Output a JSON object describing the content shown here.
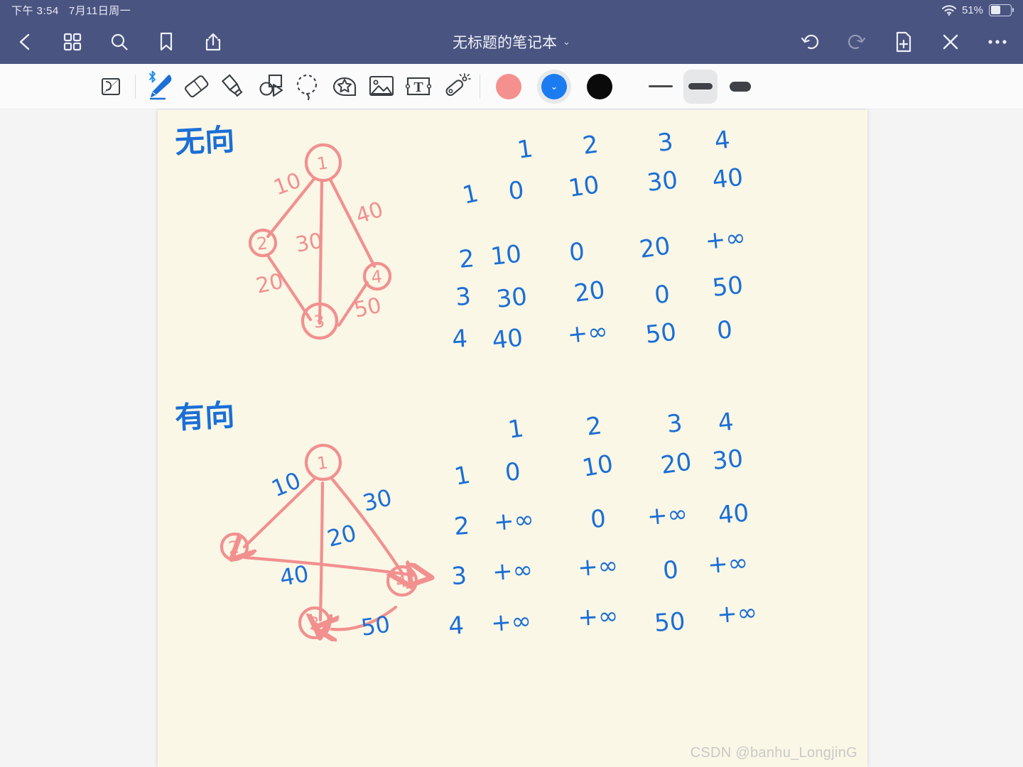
{
  "statusbar": {
    "time": "下午 3:54",
    "date": "7月11日周一",
    "battery_percent": "51%",
    "wifi_icon": "wifi-icon",
    "battery_icon": "battery-icon"
  },
  "navbar": {
    "title": "无标题的笔记本",
    "title_chevron": "⌄",
    "left_items": [
      {
        "name": "back-button",
        "icon": "chevron-left-icon"
      },
      {
        "name": "grid-view-button",
        "icon": "grid-icon"
      },
      {
        "name": "search-button",
        "icon": "search-icon"
      },
      {
        "name": "bookmark-button",
        "icon": "bookmark-icon"
      },
      {
        "name": "share-button",
        "icon": "share-icon"
      }
    ],
    "right_items": [
      {
        "name": "undo-button",
        "icon": "undo-icon"
      },
      {
        "name": "redo-button",
        "icon": "redo-icon"
      },
      {
        "name": "add-page-button",
        "icon": "document-plus-icon"
      },
      {
        "name": "close-button",
        "icon": "close-x-icon"
      },
      {
        "name": "more-button",
        "icon": "more-dots-icon"
      }
    ]
  },
  "toolbar": {
    "tools": [
      {
        "name": "page-flip-tool",
        "icon": "page-corner-icon",
        "active": false
      },
      {
        "name": "pen-tool",
        "icon": "pen-icon",
        "active": true,
        "badge": "bluetooth-icon"
      },
      {
        "name": "eraser-tool",
        "icon": "eraser-icon",
        "active": false
      },
      {
        "name": "highlighter-tool",
        "icon": "highlighter-icon",
        "active": false
      },
      {
        "name": "shapes-tool",
        "icon": "shapes-icon",
        "active": false
      },
      {
        "name": "lasso-tool",
        "icon": "lasso-dashed-circle-icon",
        "active": false
      },
      {
        "name": "sticker-tool",
        "icon": "star-sticker-icon",
        "active": false
      },
      {
        "name": "image-tool",
        "icon": "image-icon",
        "active": false
      },
      {
        "name": "text-tool",
        "icon": "text-box-icon",
        "active": false
      },
      {
        "name": "magic-tool",
        "icon": "magic-wand-icon",
        "active": false
      }
    ],
    "colors": [
      {
        "name": "color-swatch-salmon",
        "hex": "#f4918e",
        "selected": false
      },
      {
        "name": "color-swatch-blue",
        "hex": "#1a7cf0",
        "selected": true
      },
      {
        "name": "color-swatch-black",
        "hex": "#0a0a0a",
        "selected": false
      }
    ],
    "strokes": [
      {
        "name": "stroke-width-thin",
        "selected": false
      },
      {
        "name": "stroke-width-medium",
        "selected": true
      },
      {
        "name": "stroke-width-thick",
        "selected": false
      }
    ]
  },
  "canvas": {
    "watermark": "CSDN @banhu_LongjinG",
    "ink_colors": {
      "pink": "#f2908f",
      "blue": "#1b6fd6"
    },
    "sections": [
      {
        "label": "无向",
        "graph": {
          "type": "undirected",
          "nodes": [
            "1",
            "2",
            "3",
            "4"
          ],
          "edges": [
            {
              "from": "1",
              "to": "2",
              "weight": "10"
            },
            {
              "from": "1",
              "to": "3",
              "weight": "30"
            },
            {
              "from": "1",
              "to": "4",
              "weight": "40"
            },
            {
              "from": "2",
              "to": "3",
              "weight": "20"
            },
            {
              "from": "3",
              "to": "4",
              "weight": "50"
            }
          ]
        },
        "matrix": {
          "col_headers": [
            "1",
            "2",
            "3",
            "4"
          ],
          "row_headers": [
            "1",
            "2",
            "3",
            "4"
          ],
          "rows": [
            [
              "0",
              "10",
              "30",
              "40"
            ],
            [
              "10",
              "0",
              "20",
              "+∞"
            ],
            [
              "30",
              "20",
              "0",
              "50"
            ],
            [
              "40",
              "+∞",
              "50",
              "0"
            ]
          ]
        }
      },
      {
        "label": "有向",
        "graph": {
          "type": "directed",
          "nodes": [
            "1",
            "2",
            "3",
            "4"
          ],
          "edges": [
            {
              "from": "1",
              "to": "2",
              "weight": "10"
            },
            {
              "from": "1",
              "to": "3",
              "weight": "20"
            },
            {
              "from": "1",
              "to": "4",
              "weight": "30"
            },
            {
              "from": "2",
              "to": "4",
              "weight": "40"
            },
            {
              "from": "4",
              "to": "3",
              "weight": "50"
            }
          ]
        },
        "matrix": {
          "col_headers": [
            "1",
            "2",
            "3",
            "4"
          ],
          "row_headers": [
            "1",
            "2",
            "3",
            "4"
          ],
          "rows": [
            [
              "0",
              "10",
              "20",
              "30"
            ],
            [
              "+∞",
              "0",
              "+∞",
              "40"
            ],
            [
              "+∞",
              "+∞",
              "0",
              "+∞"
            ],
            [
              "+∞",
              "+∞",
              "50",
              "+∞"
            ]
          ]
        }
      }
    ]
  }
}
